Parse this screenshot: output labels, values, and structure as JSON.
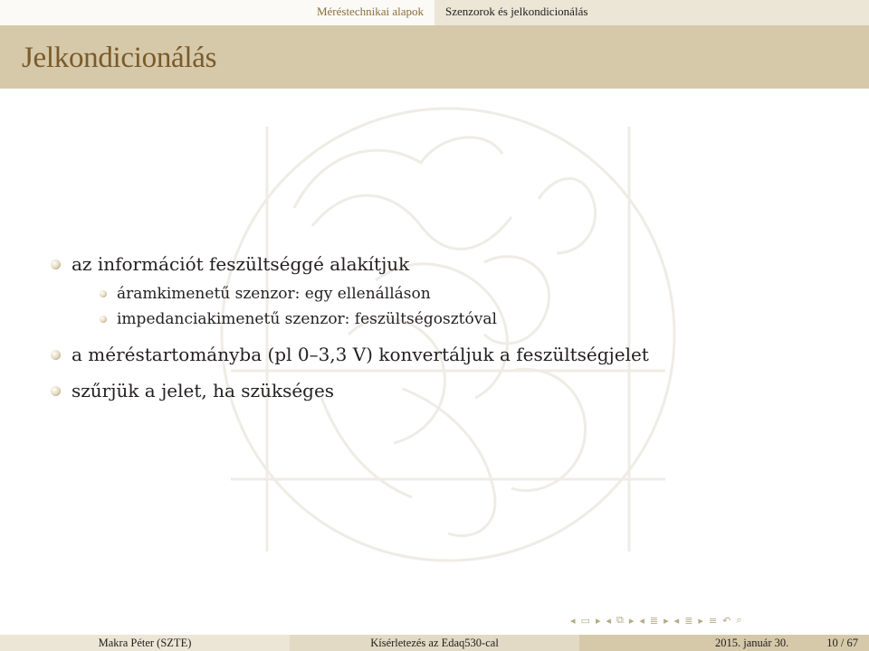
{
  "header": {
    "section_left": "Méréstechnikai alapok",
    "section_right": "Szenzorok és jelkondicionálás"
  },
  "frame": {
    "title": "Jelkondicionálás"
  },
  "bullets": [
    {
      "text": "az információt feszültséggé alakítjuk",
      "sub": [
        "áramkimenetű szenzor: egy ellenálláson",
        "impedanciakimenetű szenzor: feszültségosztóval"
      ]
    },
    {
      "text": "a méréstartományba (pl 0–3,3 V) konvertáljuk a feszültségjelet"
    },
    {
      "text": "szűrjük a jelet, ha szükséges"
    }
  ],
  "footer": {
    "author": "Makra Péter  (SZTE)",
    "short_title": "Kísérletezés az Edaq530-cal",
    "date": "2015. január 30.",
    "page": "10 / 67"
  },
  "nav_icons": [
    "left-arrow-icon",
    "frame-icon",
    "right-arrow-icon",
    "left-arrow-icon",
    "subsection-icon",
    "right-arrow-icon",
    "left-arrow-icon",
    "section-icon",
    "right-arrow-icon",
    "left-arrow-icon",
    "section-icon",
    "right-arrow-icon",
    "align-icon",
    "undo-icon",
    "search-icon"
  ]
}
